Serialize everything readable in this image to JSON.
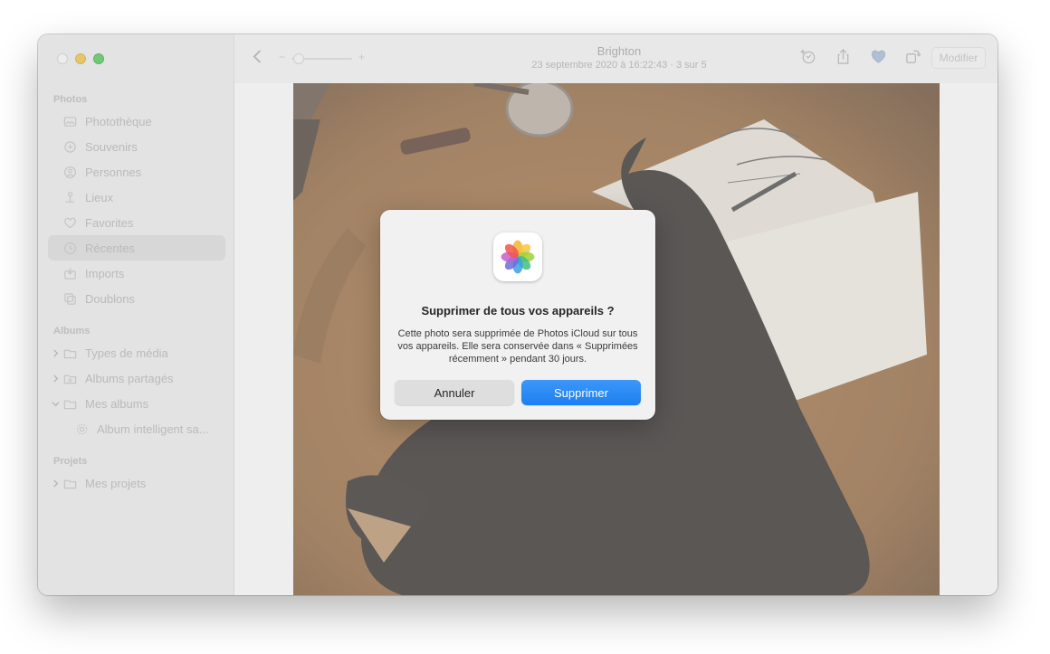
{
  "window": {
    "title": "Brighton",
    "subtitle": "23 septembre 2020 à 16:22:43  ·  3 sur 5"
  },
  "sidebar": {
    "sections": [
      {
        "label": "Photos"
      },
      {
        "label": "Albums"
      },
      {
        "label": "Projets"
      }
    ],
    "library_items": [
      {
        "label": "Photothèque",
        "icon": "photo-library-icon"
      },
      {
        "label": "Souvenirs",
        "icon": "memories-icon"
      },
      {
        "label": "Personnes",
        "icon": "people-icon"
      },
      {
        "label": "Lieux",
        "icon": "places-icon"
      },
      {
        "label": "Favorites",
        "icon": "heart-icon"
      },
      {
        "label": "Récentes",
        "icon": "clock-icon",
        "selected": true
      },
      {
        "label": "Imports",
        "icon": "imports-icon"
      },
      {
        "label": "Doublons",
        "icon": "duplicates-icon"
      }
    ],
    "album_items": [
      {
        "label": "Types de média",
        "icon": "folder-icon",
        "expanded": false
      },
      {
        "label": "Albums partagés",
        "icon": "shared-album-icon",
        "expanded": false
      },
      {
        "label": "Mes albums",
        "icon": "folder-icon",
        "expanded": true
      },
      {
        "label": "Album intelligent sa...",
        "icon": "gear-icon"
      }
    ],
    "project_items": [
      {
        "label": "Mes projets",
        "icon": "folder-icon",
        "expanded": false
      }
    ]
  },
  "toolbar": {
    "zoom_minus": "−",
    "zoom_plus": "+",
    "edit_label": "Modifier"
  },
  "dialog": {
    "title": "Supprimer de tous vos appareils ?",
    "message": "Cette photo sera supprimée de Photos iCloud sur tous vos appareils. Elle sera conservée dans « Supprimées récemment » pendant 30 jours.",
    "cancel_label": "Annuler",
    "confirm_label": "Supprimer",
    "confirm_color": "#1c7ff1"
  }
}
